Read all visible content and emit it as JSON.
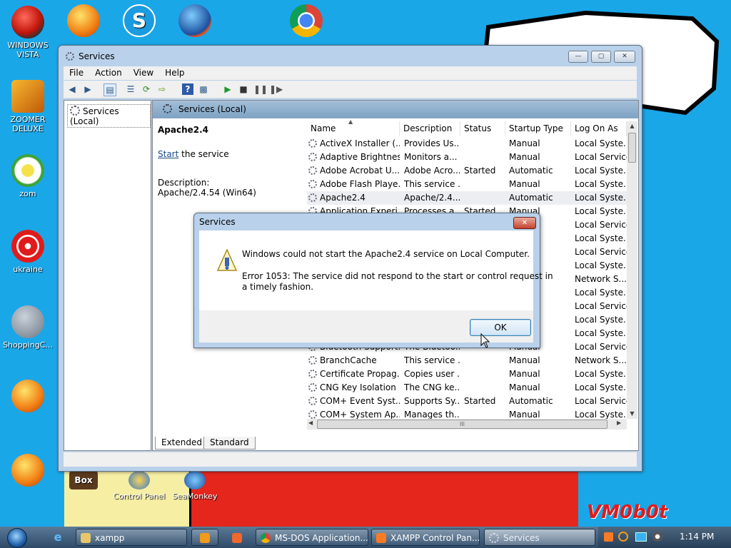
{
  "desktop": {
    "icons": [
      {
        "label": "WINDOWS VISTA",
        "icon": "vista-ball-icon"
      },
      {
        "label": "ZOOMER DELUXE",
        "icon": "zoomer-icon"
      },
      {
        "label": "zom",
        "icon": "flower-icon"
      },
      {
        "label": "ukraine",
        "icon": "radiation-icon"
      },
      {
        "label": "ShoppingC...",
        "icon": "flash-icon"
      },
      {
        "label": "",
        "icon": "peggle-icon"
      },
      {
        "label": "",
        "icon": "peggle-icon"
      },
      {
        "label": "",
        "icon": "peggle-icon"
      },
      {
        "label": "",
        "icon": "skype-icon"
      },
      {
        "label": "",
        "icon": "seamonkey-icon"
      },
      {
        "label": "",
        "icon": "chrome-icon"
      }
    ],
    "bottom_icons": [
      {
        "label": "",
        "icon": "box-icon"
      },
      {
        "label": "Control Panel",
        "icon": "control-panel-icon"
      },
      {
        "label": "SeaMonkey",
        "icon": "seamonkey-icon"
      }
    ],
    "speech_bubble": {
      "line1": "",
      "line2": ""
    },
    "signature": "VM0b0t"
  },
  "window": {
    "title": "Services",
    "menu": [
      "File",
      "Action",
      "View",
      "Help"
    ],
    "tree_item": "Services (Local)",
    "pane_header": "Services (Local)",
    "details": {
      "service_name": "Apache2.4",
      "start_link": "Start",
      "start_suffix": " the service",
      "desc_label": "Description:",
      "desc_text": "Apache/2.4.54 (Win64)"
    },
    "columns": [
      "Name",
      "Description",
      "Status",
      "Startup Type",
      "Log On As"
    ],
    "rows": [
      {
        "name": "ActiveX Installer (...",
        "desc": "Provides Us...",
        "status": "",
        "startup": "Manual",
        "logon": "Local Syste..."
      },
      {
        "name": "Adaptive Brightness",
        "desc": "Monitors a...",
        "status": "",
        "startup": "Manual",
        "logon": "Local Service"
      },
      {
        "name": "Adobe Acrobat U...",
        "desc": "Adobe Acro...",
        "status": "Started",
        "startup": "Automatic",
        "logon": "Local Syste..."
      },
      {
        "name": "Adobe Flash Playe...",
        "desc": "This service ...",
        "status": "",
        "startup": "Manual",
        "logon": "Local Syste..."
      },
      {
        "name": "Apache2.4",
        "desc": "Apache/2.4....",
        "status": "",
        "startup": "Automatic",
        "logon": "Local Syste...",
        "selected": true
      },
      {
        "name": "Application Experi...",
        "desc": "Processes a...",
        "status": "Started",
        "startup": "Manual",
        "logon": "Local Syste..."
      },
      {
        "name": "",
        "desc": "",
        "status": "",
        "startup": "",
        "logon": "Local Service"
      },
      {
        "name": "",
        "desc": "",
        "status": "",
        "startup": "",
        "logon": "Local Syste..."
      },
      {
        "name": "",
        "desc": "",
        "status": "",
        "startup": "",
        "logon": "Local Service"
      },
      {
        "name": "",
        "desc": "",
        "status": "",
        "startup": "",
        "logon": "Local Syste..."
      },
      {
        "name": "",
        "desc": "",
        "status": "",
        "startup": "",
        "logon": "Network S..."
      },
      {
        "name": "",
        "desc": "",
        "status": "",
        "startup": "ic (D...",
        "logon": "Local Syste..."
      },
      {
        "name": "",
        "desc": "",
        "status": "",
        "startup": "ic",
        "logon": "Local Service"
      },
      {
        "name": "",
        "desc": "",
        "status": "",
        "startup": "",
        "logon": "Local Syste..."
      },
      {
        "name": "",
        "desc": "",
        "status": "",
        "startup": "",
        "logon": "Local Syste..."
      },
      {
        "name": "Bluetooth Support...",
        "desc": "The Bluetoo...",
        "status": "",
        "startup": "Manual",
        "logon": "Local Service"
      },
      {
        "name": "BranchCache",
        "desc": "This service ...",
        "status": "",
        "startup": "Manual",
        "logon": "Network S..."
      },
      {
        "name": "Certificate Propag...",
        "desc": "Copies user ...",
        "status": "",
        "startup": "Manual",
        "logon": "Local Syste..."
      },
      {
        "name": "CNG Key Isolation",
        "desc": "The CNG ke...",
        "status": "",
        "startup": "Manual",
        "logon": "Local Syste..."
      },
      {
        "name": "COM+ Event Syst...",
        "desc": "Supports Sy...",
        "status": "Started",
        "startup": "Automatic",
        "logon": "Local Service"
      },
      {
        "name": "COM+ System Ap...",
        "desc": "Manages th...",
        "status": "",
        "startup": "Manual",
        "logon": "Local Syste..."
      }
    ],
    "scroll_mark": "III",
    "tabs": [
      "Extended",
      "Standard"
    ]
  },
  "dialog": {
    "title": "Services",
    "message": "Windows could not start the Apache2.4 service on Local Computer.",
    "error_line1": "Error 1053: The service did not respond to the start or control request in",
    "error_line2": "a timely fashion.",
    "ok_label": "OK"
  },
  "taskbar": {
    "buttons": [
      "xampp",
      "",
      "",
      "MS-DOS Application...",
      "XAMPP Control Pan...",
      "Services"
    ],
    "clock": "1:14 PM"
  },
  "colors": {
    "desktop": "#1aa7e8",
    "selection": "#eceef2",
    "link": "#1a4b8c"
  }
}
